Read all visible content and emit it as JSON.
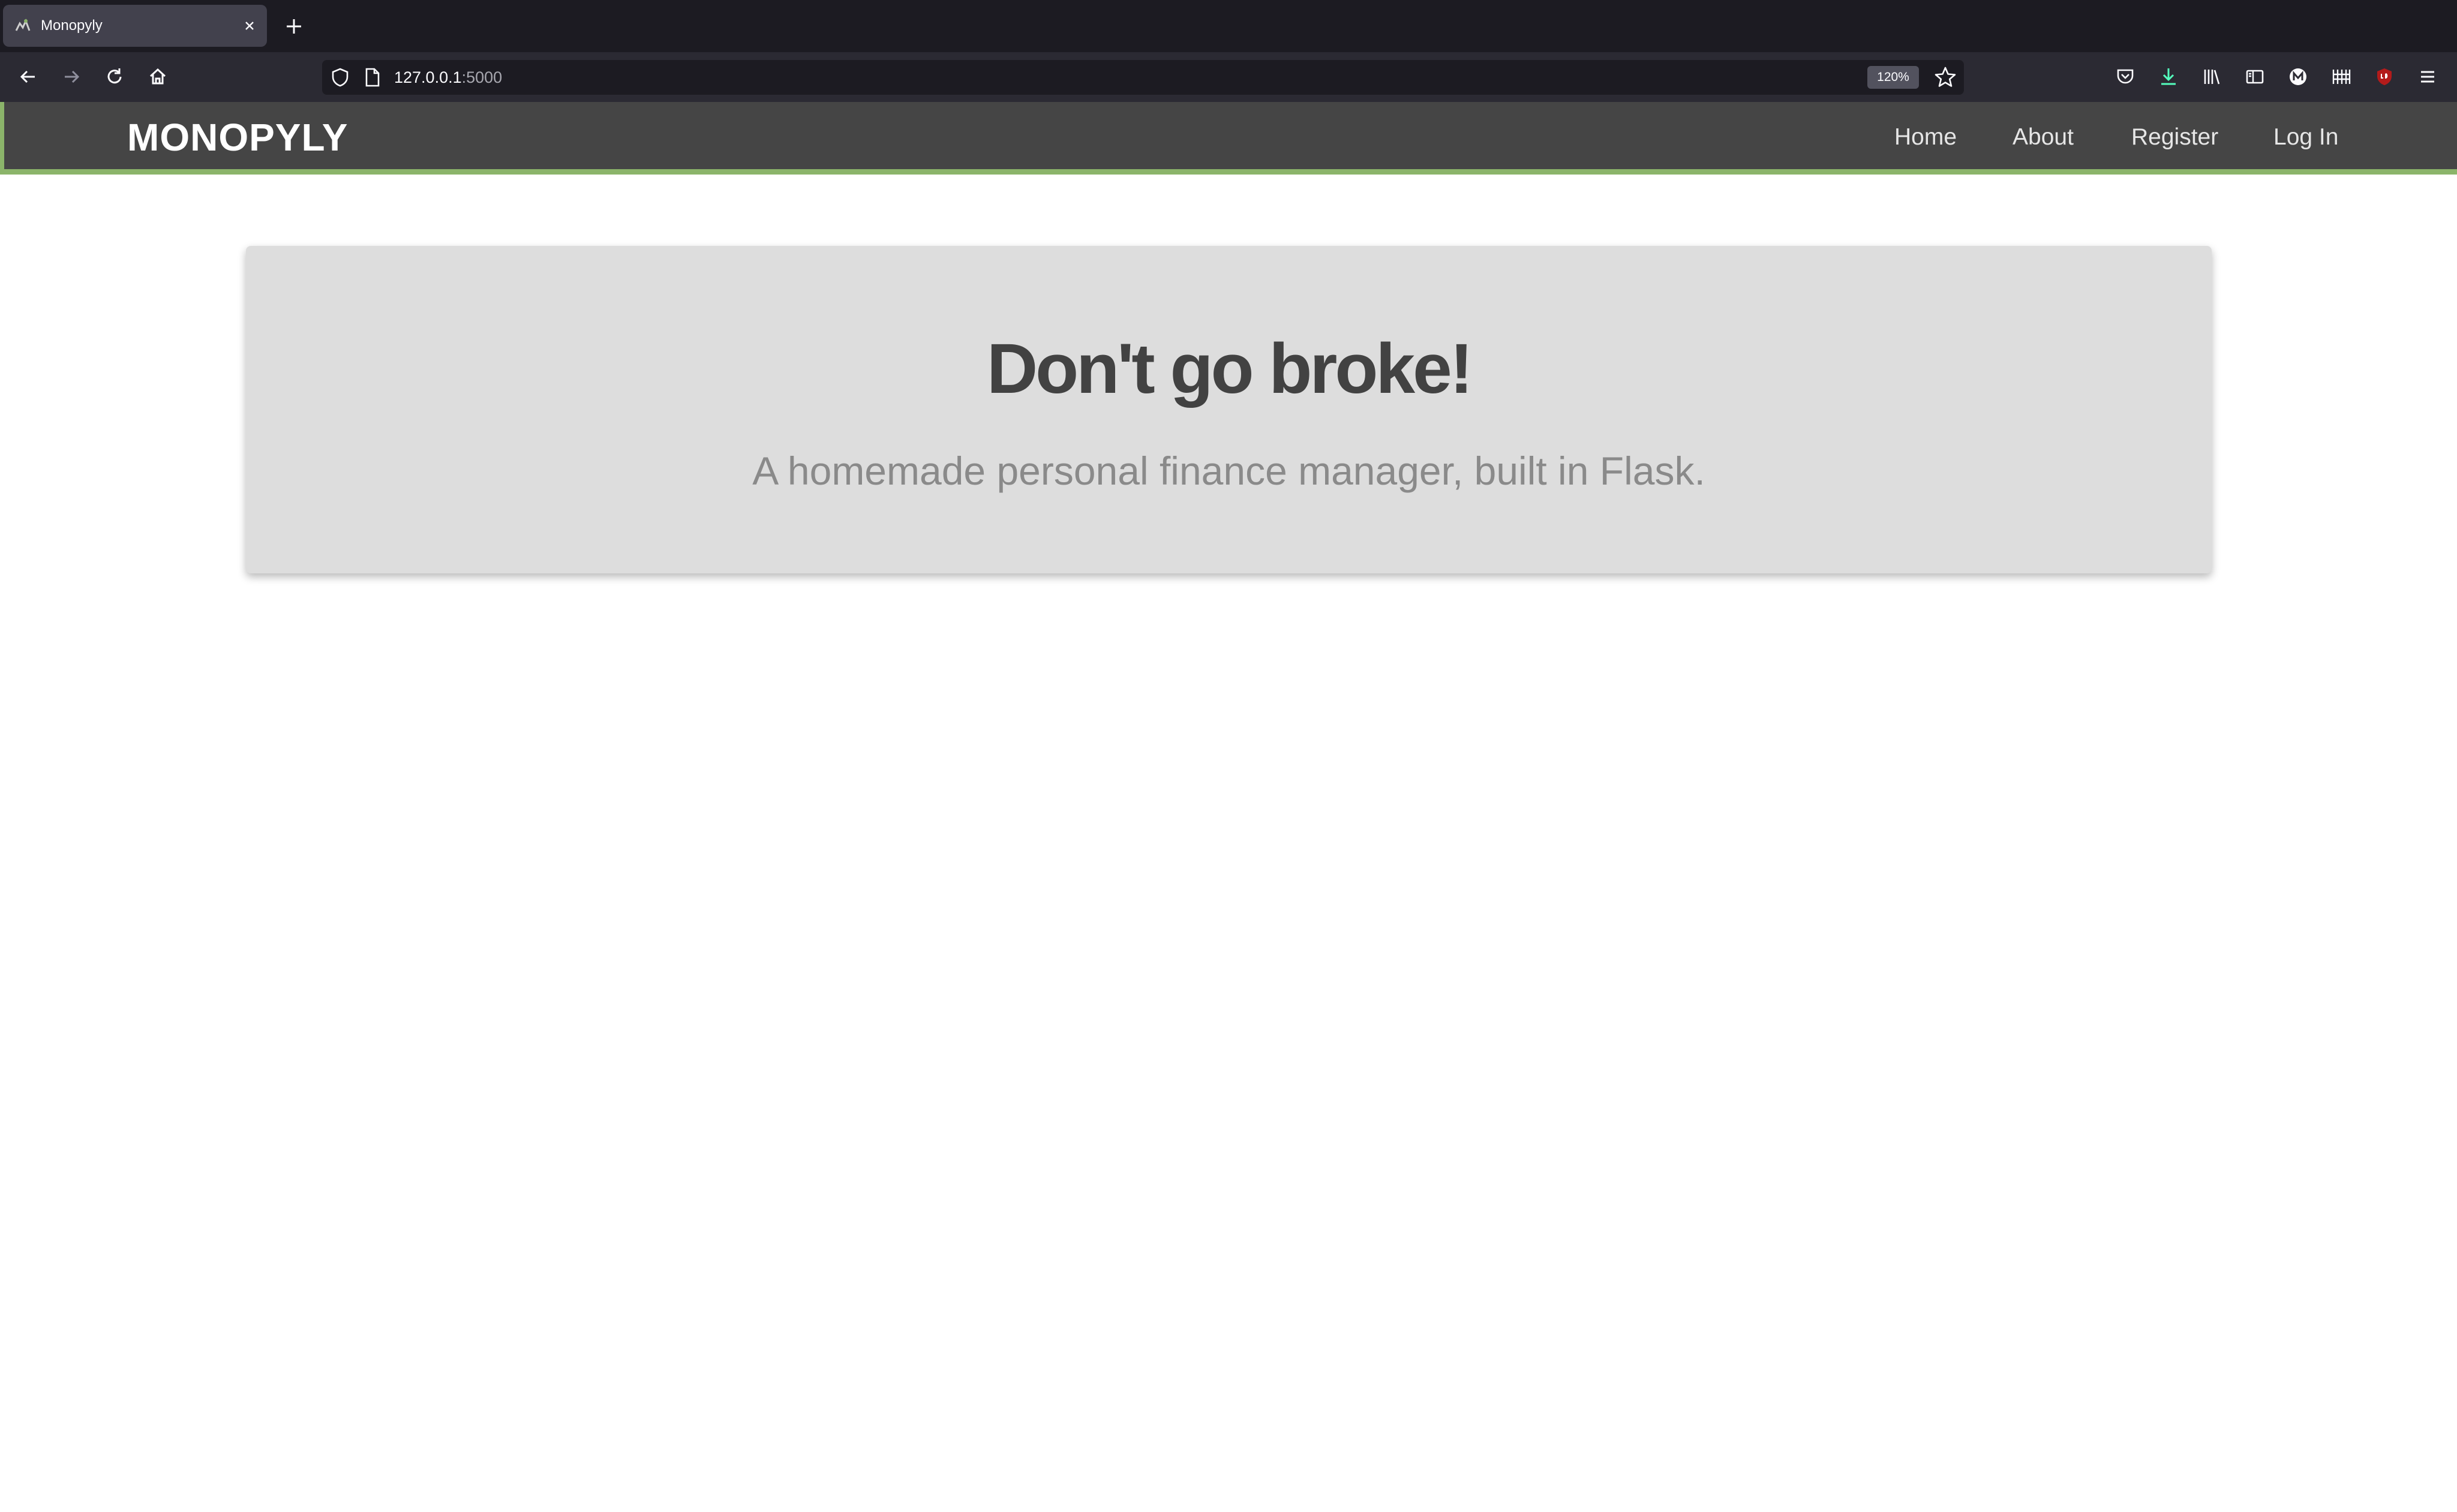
{
  "browser": {
    "tab": {
      "title": "Monopyly"
    },
    "url": {
      "host": "127.0.0.1",
      "port": ":5000"
    },
    "zoom": "120%"
  },
  "app": {
    "brand": "MONOPYLY",
    "nav": [
      {
        "label": "Home"
      },
      {
        "label": "About"
      },
      {
        "label": "Register"
      },
      {
        "label": "Log In"
      }
    ]
  },
  "hero": {
    "headline": "Don't go broke!",
    "tagline": "A homemade personal finance manager, built in Flask."
  },
  "colors": {
    "accent": "#8bb46a",
    "header_bg": "#454545",
    "jumbo_bg": "#dddddd",
    "chrome_dark": "#1c1b22",
    "chrome_toolbar": "#2b2a33"
  }
}
